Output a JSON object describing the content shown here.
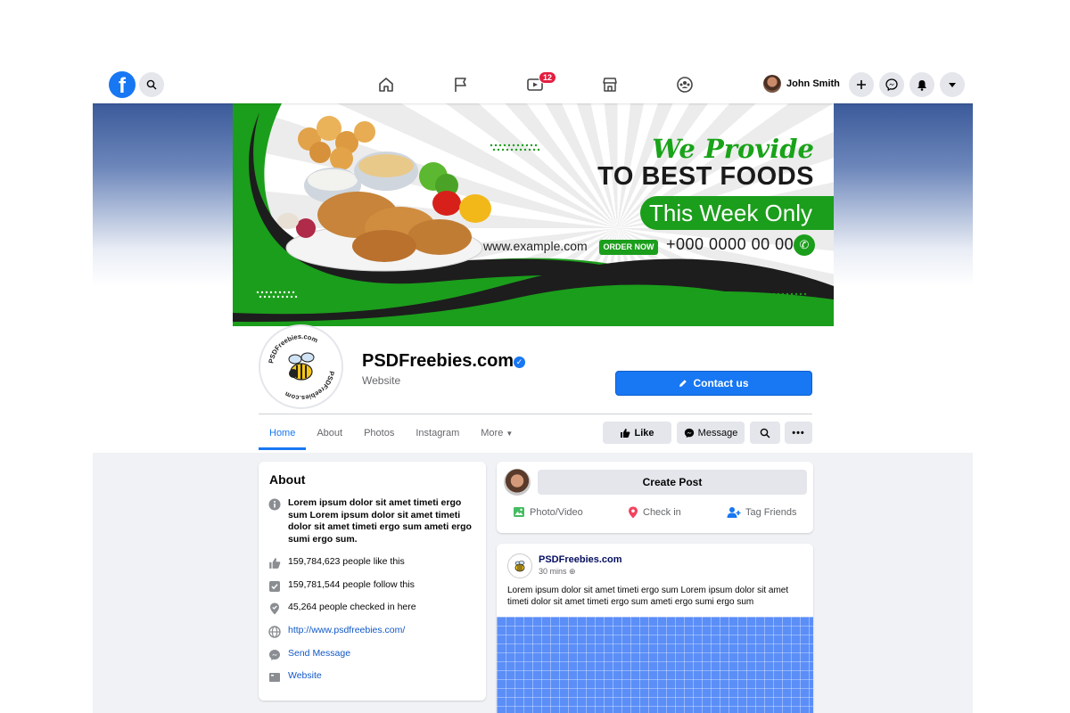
{
  "nav": {
    "logo_letter": "f",
    "notification_count": "12",
    "user_name": "John Smith"
  },
  "cover": {
    "headline_line1": "We Provide",
    "headline_line2": "TO BEST FOODS",
    "tagline": "This Week Only",
    "website": "www.example.com",
    "order_button": "ORDER NOW",
    "phone": "+000 0000 00 00"
  },
  "page": {
    "name": "PSDFreebies.com",
    "category": "Website",
    "logo_text": "PSDFreebies.com",
    "contact_button": "Contact us"
  },
  "tabs": [
    "Home",
    "About",
    "Photos",
    "Instagram",
    "More"
  ],
  "actions": {
    "like": "Like",
    "message": "Message"
  },
  "about": {
    "title": "About",
    "description": "Lorem ipsum dolor sit amet timeti ergo sum Lorem ipsum dolor sit amet timeti dolor sit amet timeti ergo sum ameti ergo sumi ergo sum.",
    "likes": "159,784,623 people like this",
    "follows": "159,781,544 people follow this",
    "checkins": "45,264 people checked in here",
    "url": "http://www.psdfreebies.com/",
    "send_message": "Send Message",
    "website": "Website"
  },
  "create_post": {
    "label": "Create Post",
    "photo_video": "Photo/Video",
    "check_in": "Check in",
    "tag_friends": "Tag Friends"
  },
  "post": {
    "author": "PSDFreebies.com",
    "time": "30 mins",
    "text": "Lorem ipsum dolor sit amet timeti ergo sum Lorem ipsum dolor sit amet timeti dolor sit amet timeti ergo sum ameti ergo sumi ergo sum"
  },
  "colors": {
    "facebook_blue": "#1877f2",
    "cover_green": "#1b9e1b",
    "notification_red": "#e41e3f"
  }
}
